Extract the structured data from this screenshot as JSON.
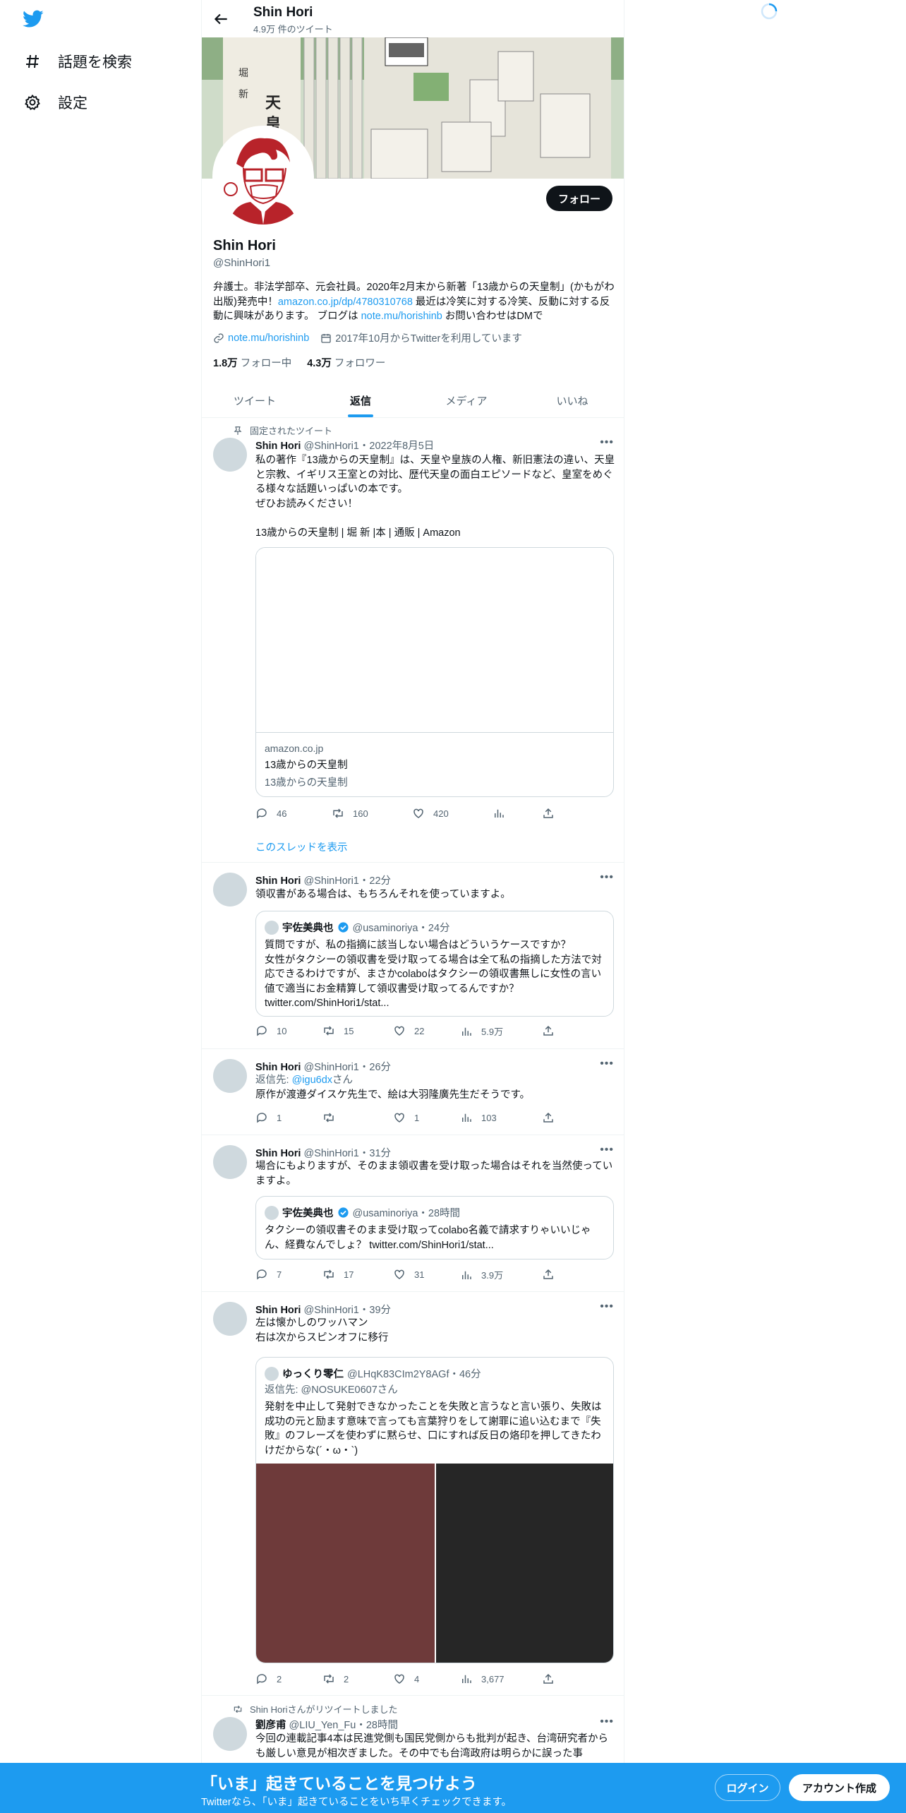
{
  "nav": {
    "explore_label": "話題を検索",
    "settings_label": "設定"
  },
  "header": {
    "name": "Shin Hori",
    "tweet_count": "4.9万 件のツイート"
  },
  "profile": {
    "follow_label": "フォロー",
    "name": "Shin Hori",
    "handle": "@ShinHori1",
    "bio_part1": "弁護士。非法学部卒、元会社員。2020年2月末から新著「13歳からの天皇制」(かもがわ出版)発売中！",
    "bio_link1": "amazon.co.jp/dp/4780310768",
    "bio_part2": " 最近は冷笑に対する冷笑、反動に対する反動に興味があります。 ブログは ",
    "bio_link2": "note.mu/horishinb",
    "bio_part3": " お問い合わせはDMで",
    "website": "note.mu/horishinb",
    "joined": "2017年10月からTwitterを利用しています",
    "following_count": "1.8万",
    "following_label": "フォロー中",
    "followers_count": "4.3万",
    "followers_label": "フォロワー"
  },
  "tabs": [
    "ツイート",
    "返信",
    "メディア",
    "いいね"
  ],
  "tweets": [
    {
      "social": "固定されたツイート",
      "name": "Shin Hori",
      "meta": "@ShinHori1・2022年8月5日",
      "text": "私の著作『13歳からの天皇制』は、天皇や皇族の人権、新旧憲法の違い、天皇と宗教、イギリス王室との対比、歴代天皇の面白エピソードなど、皇室をめぐる様々な話題いっぱいの本です。\nぜひお読みください！\n\n13歳からの天皇制 | 堀 新 |本 | 通販 | Amazon",
      "card_domain": "amazon.co.jp",
      "card_title": "13歳からの天皇制",
      "card_desc": "13歳からの天皇制",
      "replies": "46",
      "retweets": "160",
      "likes": "420",
      "show_thread": "このスレッドを表示"
    },
    {
      "name": "Shin Hori",
      "meta": "@ShinHori1・22分",
      "text": "領収書がある場合は、もちろんそれを使っていますよ。",
      "quote_name": "宇佐美典也",
      "quote_meta": "@usaminoriya・24分",
      "quote_text": "質問ですが、私の指摘に該当しない場合はどういうケースですか？\n女性がタクシーの領収書を受け取ってる場合は全て私の指摘した方法で対応できるわけですが、まさかcolaboはタクシーの領収書無しに女性の言い値で適当にお金精算して領収書受け取ってるんですか？ twitter.com/ShinHori1/stat...",
      "replies": "10",
      "retweets": "15",
      "likes": "22",
      "views": "5.9万"
    },
    {
      "name": "Shin Hori",
      "meta": "@ShinHori1・26分",
      "reply_to_label": "返信先: ",
      "reply_to_handle": "@igu6dx",
      "reply_to_suffix": "さん",
      "text": "原作が渡遵ダイスケ先生で、絵は大羽隆廣先生だそうです。",
      "replies": "1",
      "retweets": "",
      "likes": "1",
      "views": "103"
    },
    {
      "name": "Shin Hori",
      "meta": "@ShinHori1・31分",
      "text": "場合にもよりますが、そのまま領収書を受け取った場合はそれを当然使っていますよ。",
      "quote_name": "宇佐美典也",
      "quote_meta": "@usaminoriya・28時間",
      "quote_text": "タクシーの領収書そのまま受け取ってcolabo名義で請求すりゃいいじゃん、経費なんでしょ？ twitter.com/ShinHori1/stat...",
      "replies": "7",
      "retweets": "17",
      "likes": "31",
      "views": "3.9万"
    },
    {
      "name": "Shin Hori",
      "meta": "@ShinHori1・39分",
      "text": "左は懐かしのワッハマン\n右は次からスピンオフに移行",
      "quote_name": "ゆっくり零仁",
      "quote_meta": "@LHqK83CIm2Y8AGf・46分",
      "quote_reply": "返信先: @NOSUKE0607さん",
      "quote_text": "発射を中止して発射できなかったことを失敗と言うなと言い張り、失敗は成功の元と励ます意味で言っても言葉狩りをして謝罪に追い込むまで『失敗』のフレーズを使わずに黙らせ、口にすれば反日の烙印を押してきたわけだからな(´・ω・`)",
      "replies": "2",
      "retweets": "2",
      "likes": "4",
      "views": "3,677"
    },
    {
      "social": "Shin Horiさんがリツイートしました",
      "name": "劉彦甫",
      "meta": "@LIU_Yen_Fu・28時間",
      "text": "今回の連載記事4本は民進党側も国民党側からも批判が起き、台湾研究者からも厳しい意見が相次ぎました。その中でも台湾政府は明らかに誤った事"
    }
  ],
  "bottom_bar": {
    "title": "「いま」起きていることを見つけよう",
    "subtitle": "Twitterなら、「いま」起きていることをいち早くチェックできます。",
    "login_label": "ログイン",
    "signup_label": "アカウント作成"
  },
  "colors": {
    "accent": "#1d9bf0",
    "text": "#0f1419",
    "secondary": "#536471",
    "media_left": "#6e3a3a",
    "media_right": "#262626"
  }
}
